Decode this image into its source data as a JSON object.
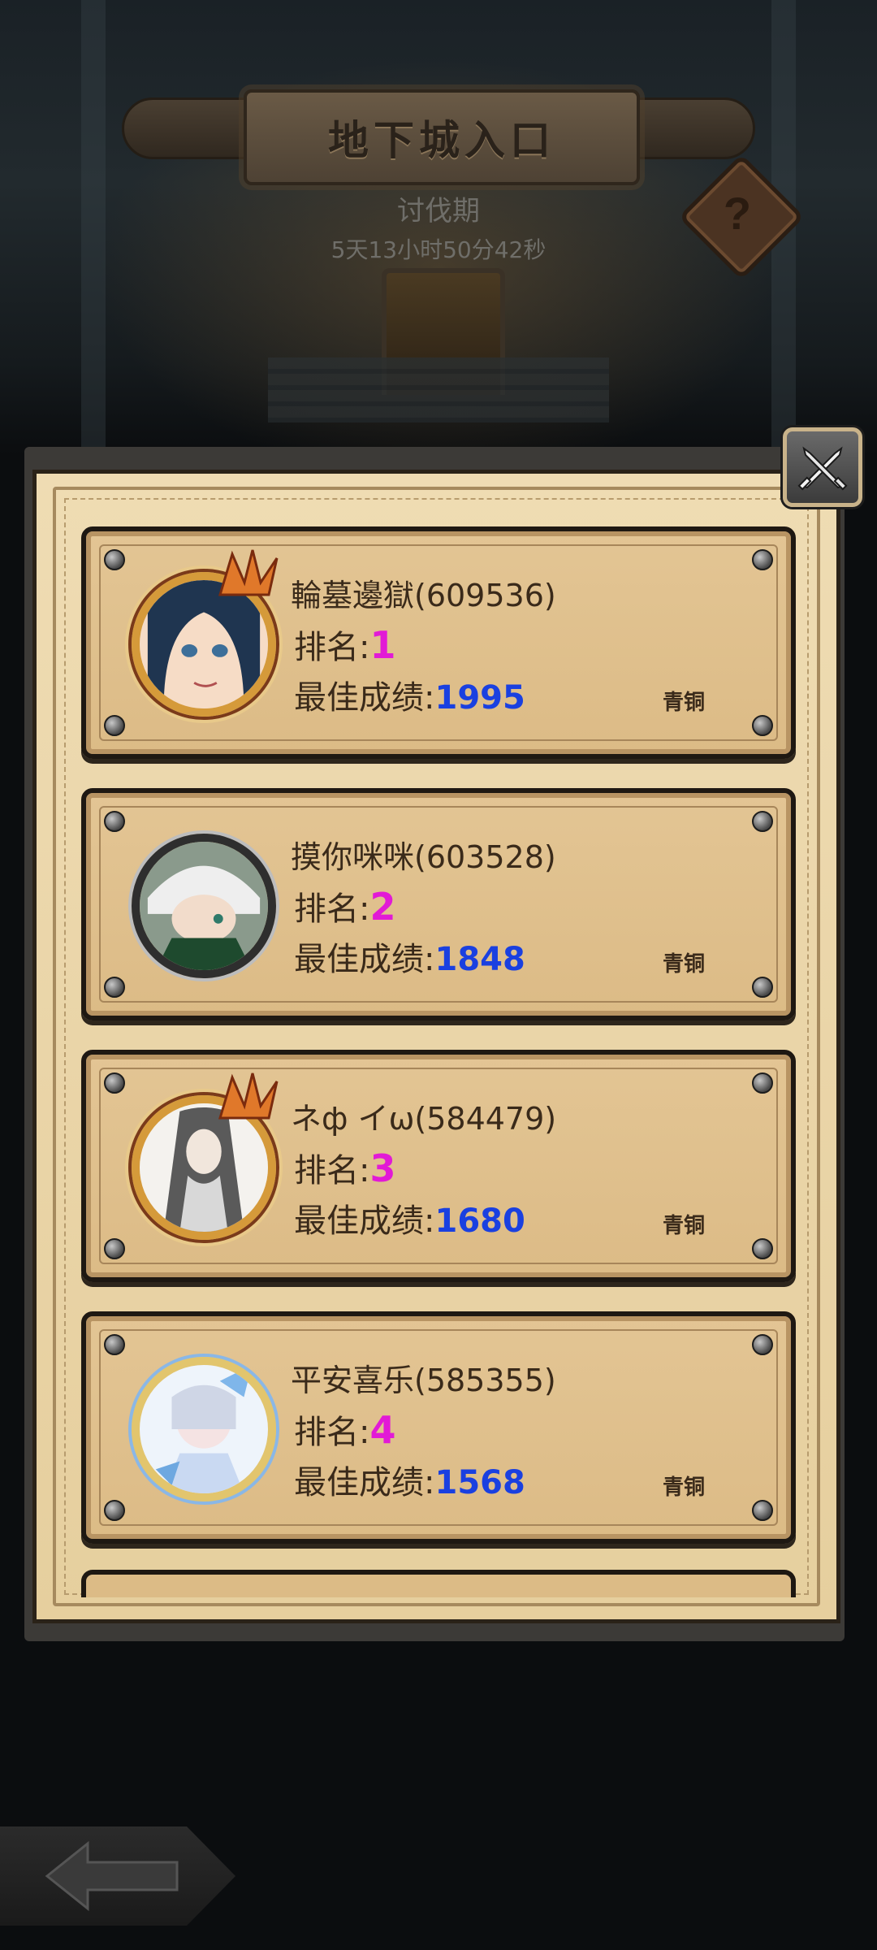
{
  "header": {
    "title": "地下城入口",
    "period_label": "讨伐期",
    "countdown": "5天13小时50分42秒"
  },
  "icons": {
    "help": "question-mark-icon",
    "close": "crossed-swords-close-icon",
    "back": "left-arrow-icon"
  },
  "help_glyph": "?",
  "rank_label": "排名:",
  "score_label": "最佳成绩:",
  "players": [
    {
      "name": "輪墓邊獄(609536)",
      "rank": "1",
      "score": "1995",
      "tier": "青铜"
    },
    {
      "name": "摸你咪咪(603528)",
      "rank": "2",
      "score": "1848",
      "tier": "青铜"
    },
    {
      "name": "ネф イω(584479)",
      "rank": "3",
      "score": "1680",
      "tier": "青铜"
    },
    {
      "name": "平安喜乐(585355)",
      "rank": "4",
      "score": "1568",
      "tier": "青铜"
    }
  ],
  "colors": {
    "rank": "#e21ad6",
    "score": "#1a40e0",
    "parchment": "#ead5a8"
  }
}
